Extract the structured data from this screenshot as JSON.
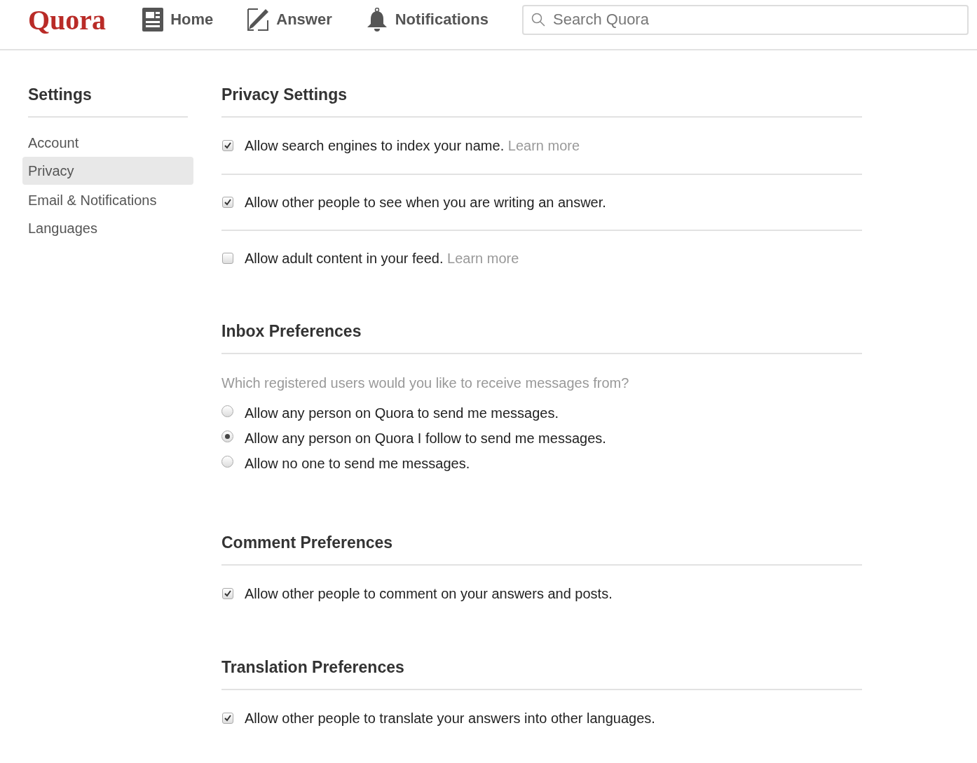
{
  "header": {
    "logo": "Quora",
    "nav": [
      {
        "label": "Home",
        "kind": "home"
      },
      {
        "label": "Answer",
        "kind": "answer"
      },
      {
        "label": "Notifications",
        "kind": "bell"
      }
    ],
    "search": {
      "placeholder": "Search Quora"
    }
  },
  "sidebar": {
    "title": "Settings",
    "items": [
      {
        "label": "Account",
        "selected": false
      },
      {
        "label": "Privacy",
        "selected": true
      },
      {
        "label": "Email & Notifications",
        "selected": false
      },
      {
        "label": "Languages",
        "selected": false
      }
    ]
  },
  "sections": [
    {
      "title": "Privacy Settings",
      "items": [
        {
          "kind": "checkbox",
          "label": "Allow search engines to index your name.",
          "link": "Learn more",
          "checked": true
        },
        {
          "kind": "checkbox",
          "label": "Allow other people to see when you are writing an answer.",
          "checked": true
        },
        {
          "kind": "checkbox",
          "label": "Allow adult content in your feed.",
          "link": "Learn more",
          "checked": false
        }
      ]
    },
    {
      "title": "Inbox Preferences",
      "items": [
        {
          "kind": "question",
          "label": "Which registered users would you like to receive messages from?"
        },
        {
          "kind": "radio",
          "label": "Allow any person on Quora to send me messages.",
          "selected": false
        },
        {
          "kind": "radio",
          "label": "Allow any person on Quora I follow to send me messages.",
          "selected": true
        },
        {
          "kind": "radio",
          "label": "Allow no one to send me messages.",
          "selected": false
        }
      ]
    },
    {
      "title": "Comment Preferences",
      "items": [
        {
          "kind": "checkbox",
          "label": "Allow other people to comment on your answers and posts.",
          "checked": true
        }
      ]
    },
    {
      "title": "Translation Preferences",
      "items": [
        {
          "kind": "checkbox",
          "label": "Allow other people to translate your answers into other languages.",
          "checked": true
        }
      ]
    }
  ]
}
